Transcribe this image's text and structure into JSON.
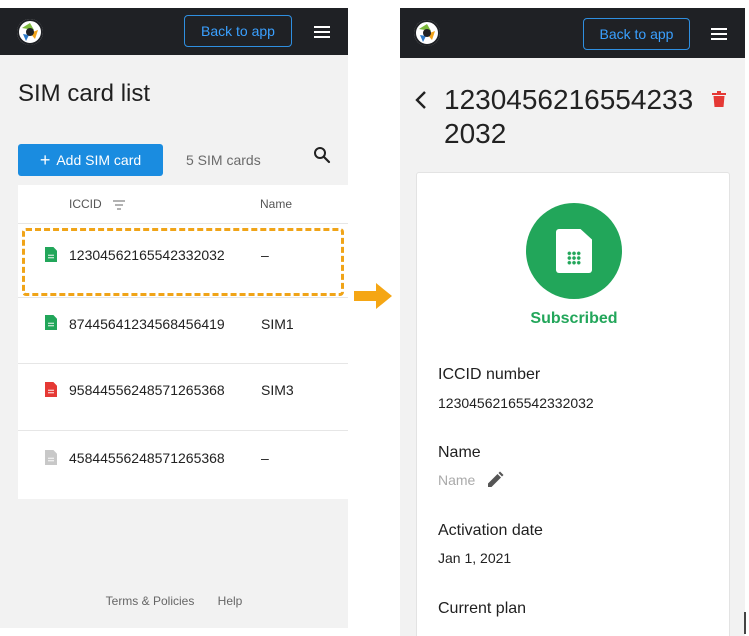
{
  "colors": {
    "accent": "#1a8ce0",
    "topbar": "#1f2125",
    "sim_active": "#22a65a",
    "sim_error": "#e53935",
    "sim_inactive": "#c8c8c8",
    "highlight": "#f0a418"
  },
  "list_screen": {
    "header": {
      "back_label": "Back to app",
      "logo_icon": "app-logo-icon",
      "menu_icon": "hamburger-menu-icon"
    },
    "title": "SIM card list",
    "add_label": "Add SIM card",
    "count_label": "5 SIM cards",
    "columns": {
      "iccid": "ICCID",
      "name": "Name"
    },
    "rows": [
      {
        "iccid": "12304562165542332032",
        "name": "–",
        "status": "active"
      },
      {
        "iccid": "87445641234568456419",
        "name": "SIM1",
        "status": "active"
      },
      {
        "iccid": "95844556248571265368",
        "name": "SIM3",
        "status": "error"
      },
      {
        "iccid": "45844556248571265368",
        "name": "–",
        "status": "inactive"
      }
    ],
    "footer": {
      "terms": "Terms & Policies",
      "help": "Help"
    }
  },
  "detail_screen": {
    "header": {
      "back_label": "Back to app"
    },
    "title": "12304562165542332032",
    "status": "Subscribed",
    "fields": {
      "iccid_label": "ICCID number",
      "iccid_value": "12304562165542332032",
      "name_label": "Name",
      "name_placeholder": "Name",
      "activation_label": "Activation date",
      "activation_value": "Jan 1, 2021",
      "plan_label": "Current plan"
    }
  }
}
